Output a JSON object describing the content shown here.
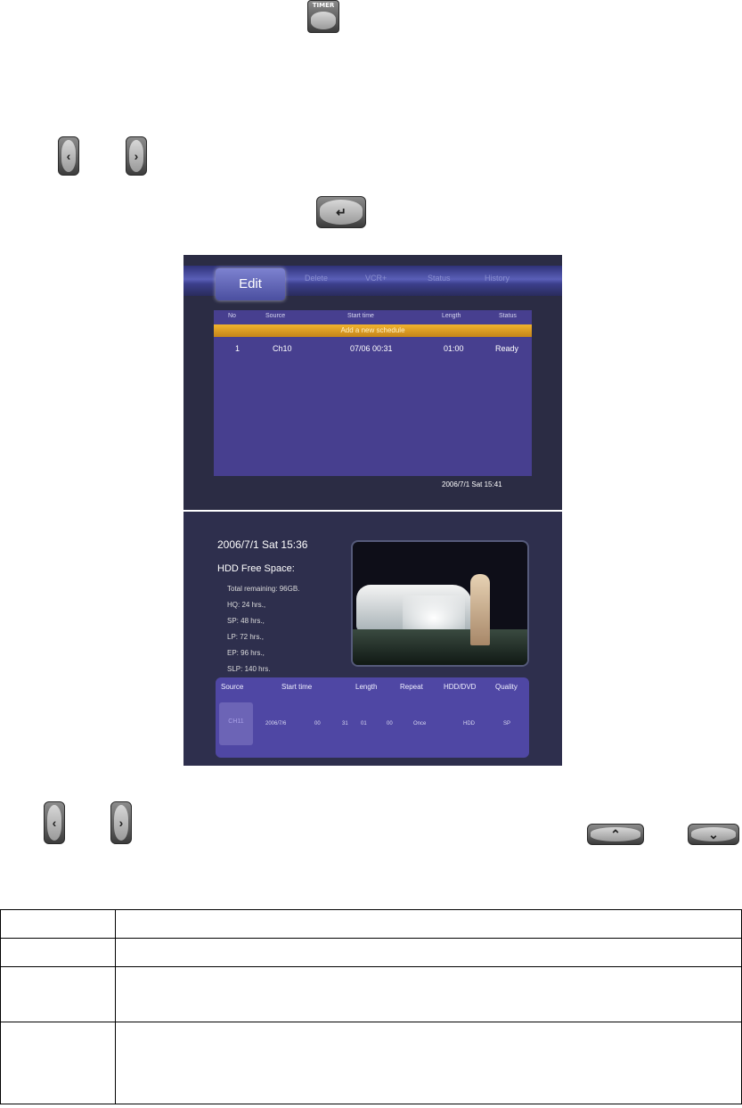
{
  "remote": {
    "timer_label": "TIMER",
    "left_glyph": "‹",
    "right_glyph": "›",
    "up_glyph": "⌃",
    "down_glyph": "⌄",
    "enter_glyph": "↵"
  },
  "screen1": {
    "tabs": {
      "active": "Edit",
      "delete": "Delete",
      "vcr": "VCR+",
      "status": "Status",
      "history": "History"
    },
    "columns": {
      "no": "No",
      "source": "Source",
      "start_time": "Start time",
      "length": "Length",
      "status": "Status"
    },
    "add_row": "Add a new schedule",
    "schedule": {
      "no": "1",
      "source": "Ch10",
      "start_time": "07/06 00:31",
      "length": "01:00",
      "status": "Ready"
    },
    "datetime": "2006/7/1 Sat 15:41"
  },
  "screen2": {
    "datetime": "2006/7/1 Sat 15:36",
    "hdd_title": "HDD Free Space:",
    "lines": [
      "Total remaining: 96GB.",
      "HQ: 24 hrs.,",
      "SP: 48 hrs.,",
      "LP: 72 hrs.,",
      "EP: 96 hrs.,",
      "SLP: 140 hrs."
    ],
    "headers": {
      "source": "Source",
      "start_time": "Start time",
      "length": "Length",
      "repeat": "Repeat",
      "hdd_dvd": "HDD/DVD",
      "quality": "Quality"
    },
    "values": {
      "source": "CH11",
      "date": "2006/7/6",
      "h1": "00",
      "m1": "31",
      "h2": "01",
      "m2": "00",
      "repeat": "Once",
      "hdd_dvd": "HDD",
      "quality": "SP"
    }
  },
  "table": {
    "rows": [
      [
        "",
        ""
      ],
      [
        "",
        ""
      ],
      [
        "",
        ""
      ],
      [
        "",
        ""
      ]
    ]
  }
}
